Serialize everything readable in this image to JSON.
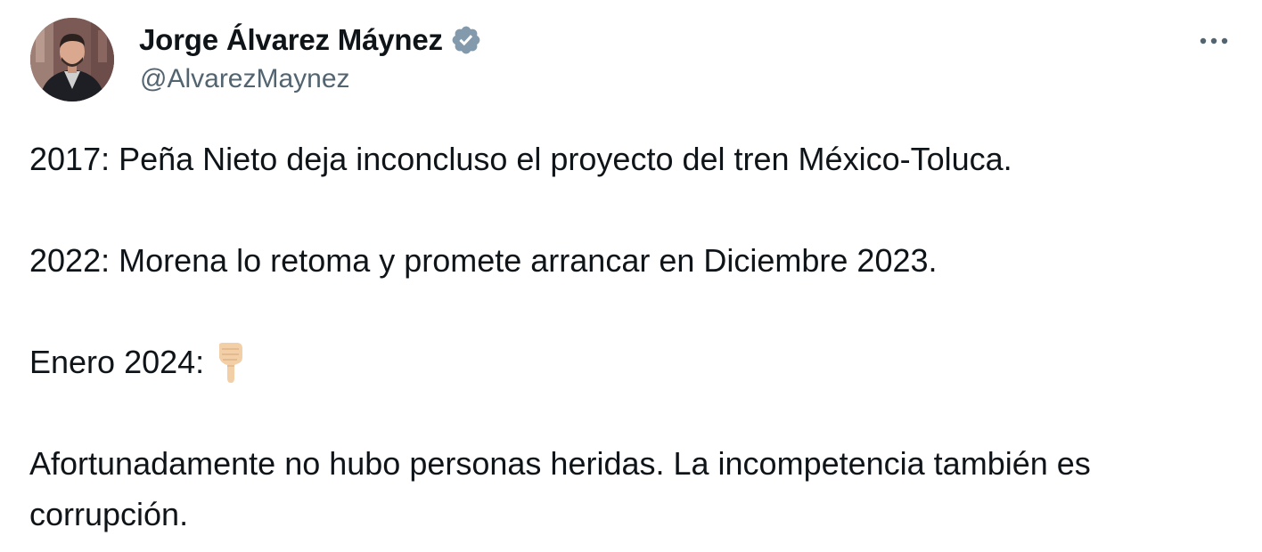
{
  "author": {
    "display_name": "Jorge Álvarez Máynez",
    "handle": "@AlvarezMaynez",
    "verified": true,
    "verified_badge_color": "#829aab"
  },
  "more_icon": "more-horizontal-icon",
  "tweet": {
    "lines": [
      "2017: Peña Nieto deja inconcluso el proyecto del tren México-Toluca.",
      "2022: Morena lo retoma y promete arrancar en Diciembre 2023.",
      "Enero 2024:",
      "Afortunadamente no hubo personas heridas. La incompetencia también es corrupción."
    ],
    "emoji": "backhand-index-pointing-down-emoji"
  },
  "colors": {
    "text": "#0f1419",
    "secondary": "#536471",
    "background": "#ffffff"
  }
}
